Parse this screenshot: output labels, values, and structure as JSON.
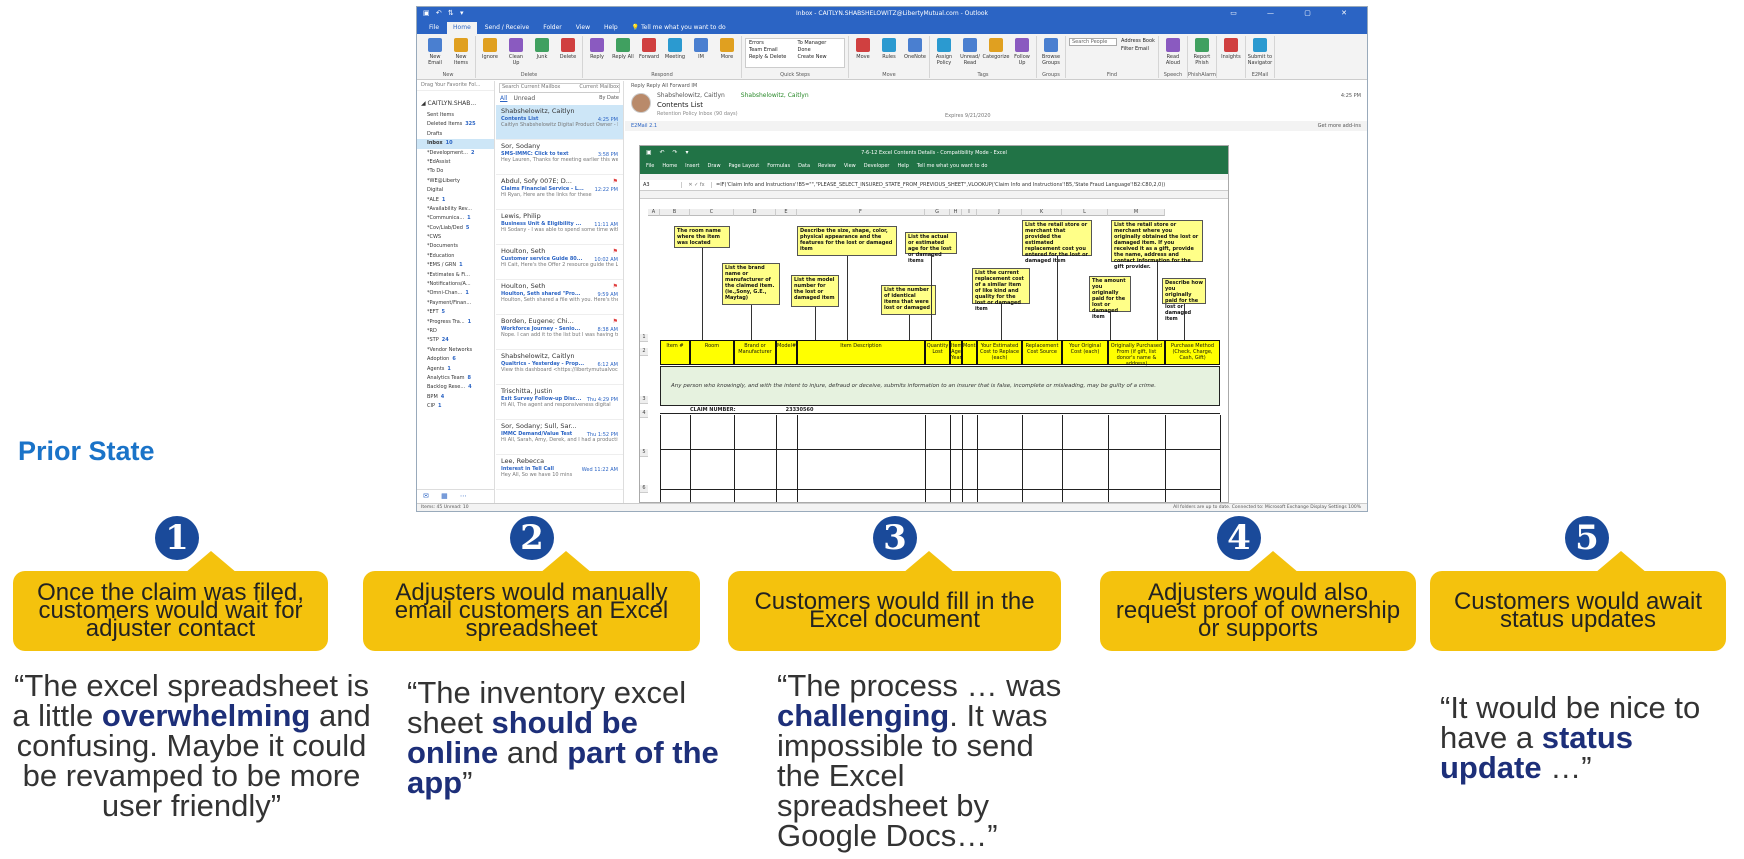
{
  "outlook": {
    "window_title": "Inbox - CAITLYN.SHABSHELOWITZ@LibertyMutual.com - Outlook",
    "menu_tabs": [
      "File",
      "Home",
      "Send / Receive",
      "Folder",
      "View",
      "Help"
    ],
    "tell_me": "Tell me what you want to do",
    "ribbon_groups": [
      {
        "label": "New",
        "buttons": [
          "New Email",
          "New Items"
        ]
      },
      {
        "label": "Delete",
        "buttons": [
          "Ignore",
          "Clean Up",
          "Junk",
          "Delete"
        ]
      },
      {
        "label": "Respond",
        "buttons": [
          "Reply",
          "Reply All",
          "Forward",
          "Meeting",
          "IM",
          "More"
        ]
      },
      {
        "label": "Quick Steps",
        "buttons": [
          "Errors",
          "Team Email",
          "Reply & Delete",
          "To Manager",
          "Done",
          "Create New"
        ]
      },
      {
        "label": "Move",
        "buttons": [
          "Move",
          "Rules",
          "OneNote"
        ]
      },
      {
        "label": "Tags",
        "buttons": [
          "Assign Policy",
          "Unread/ Read",
          "Categorize",
          "Follow Up"
        ]
      },
      {
        "label": "Groups",
        "buttons": [
          "Browse Groups"
        ]
      },
      {
        "label": "Find",
        "buttons": [
          "Search People",
          "Address Book",
          "Filter Email"
        ]
      },
      {
        "label": "Speech",
        "buttons": [
          "Read Aloud"
        ]
      },
      {
        "label": "PhishAlarm",
        "buttons": [
          "Report Phish"
        ]
      },
      {
        "label": "",
        "buttons": [
          "Insights"
        ]
      },
      {
        "label": "E2Mail",
        "buttons": [
          "Submit to Navigator"
        ]
      }
    ],
    "favorites_hint": "Drag Your Favorite Fol...",
    "folders": [
      {
        "name": "CAITLYN.SHAB...",
        "count": "",
        "kind": "acct"
      },
      {
        "name": "Sent Items",
        "count": ""
      },
      {
        "name": "Deleted Items",
        "count": "325"
      },
      {
        "name": "Drafts",
        "count": ""
      },
      {
        "name": "Inbox",
        "count": "10",
        "kind": "sel"
      },
      {
        "name": "*Development...",
        "count": "2"
      },
      {
        "name": "*EdAssist",
        "count": ""
      },
      {
        "name": "*To Do",
        "count": ""
      },
      {
        "name": "*WE@Liberty",
        "count": ""
      },
      {
        "name": "Digital",
        "count": ""
      },
      {
        "name": "*ALE",
        "count": "1"
      },
      {
        "name": "*Availability Rev...",
        "count": ""
      },
      {
        "name": "*Communica...",
        "count": "1"
      },
      {
        "name": "*Cov/Liab/Ded",
        "count": "5"
      },
      {
        "name": "*CWS",
        "count": ""
      },
      {
        "name": "*Documents",
        "count": ""
      },
      {
        "name": "*Education",
        "count": ""
      },
      {
        "name": "*EMS / GRN",
        "count": "1"
      },
      {
        "name": "*Estimates & Fi...",
        "count": ""
      },
      {
        "name": "*Notifications/A...",
        "count": ""
      },
      {
        "name": "*Omni-Chan...",
        "count": "1"
      },
      {
        "name": "*Payment/Finan...",
        "count": ""
      },
      {
        "name": "*EFT",
        "count": "5"
      },
      {
        "name": "*Progress Tra...",
        "count": "1"
      },
      {
        "name": "*RD",
        "count": ""
      },
      {
        "name": "*STP",
        "count": "24"
      },
      {
        "name": "*Vendor Networks",
        "count": ""
      },
      {
        "name": "Adoption",
        "count": "6"
      },
      {
        "name": "Agents",
        "count": "1"
      },
      {
        "name": "Analytics Team",
        "count": "8"
      },
      {
        "name": "Backlog Rese...",
        "count": "4"
      },
      {
        "name": "BPM",
        "count": "4"
      },
      {
        "name": "CIP",
        "count": "1"
      }
    ],
    "list_search": "Search Current Mailbox",
    "list_scope": "Current Mailbox",
    "filters": [
      "All",
      "Unread"
    ],
    "sort": "By Date",
    "mails": [
      {
        "sender": "Shabshelowitz, Caitlyn",
        "subject": "Contents List",
        "preview": "Caitlyn Shabshelowitz Digital Product Owner - I",
        "time": "4:25 PM",
        "selected": true,
        "flag": ""
      },
      {
        "sender": "Sor, Sodany",
        "subject": "SMS-IMMC: Click to text",
        "preview": "Hey Lauren, Thanks for meeting earlier this week.",
        "time": "3:58 PM",
        "selected": false,
        "flag": ""
      },
      {
        "sender": "Abdul, Sofy 007E; D...",
        "subject": "Claims Financial Service - L...",
        "preview": "Hi Ryan, Here are the links for these",
        "time": "12:22 PM",
        "selected": false,
        "flag": "⚑"
      },
      {
        "sender": "Lewis, Philip",
        "subject": "Business Unit & Eligibility ...",
        "preview": "Hi Sodany - I was able to spend some time with the",
        "time": "11:11 AM",
        "selected": false,
        "flag": ""
      },
      {
        "sender": "Houlton, Seth",
        "subject": "Customer service Guide 80...",
        "preview": "Hi Cait, Here's the Offer 2 resource guide the Lake",
        "time": "10:02 AM",
        "selected": false,
        "flag": "⚑"
      },
      {
        "sender": "Houlton, Seth",
        "subject": "Houlton, Seth shared \"Pro...",
        "preview": "Houlton, Seth shared a file with you. Here's the Offer 2",
        "time": "9:59 AM",
        "selected": false,
        "flag": "⚑"
      },
      {
        "sender": "Borden, Eugene; Chi...",
        "subject": "Workforce Journey - Senio...",
        "preview": "Nope. I can add it to the list but I was having trouble",
        "time": "8:38 AM",
        "selected": false,
        "flag": "⚑"
      },
      {
        "sender": "Shabshelowitz, Caitlyn",
        "subject": "Qualtrics - Yesterday - Prop...",
        "preview": "View this dashboard <https://libertymutualvoc.co",
        "time": "6:12 AM",
        "selected": false,
        "flag": ""
      },
      {
        "sender": "Trischitta, Justin",
        "subject": "Exit Survey Follow-up Disc...",
        "preview": "Hi All, The agent and responsiveness digital",
        "time": "Thu 4:29 PM",
        "selected": false,
        "flag": ""
      },
      {
        "sender": "Sor, Sodany; Sull, Sar...",
        "subject": "IMMC Demand/Value Test",
        "preview": "Hi All, Sarah, Amy, Derek, and I had a productive",
        "time": "Thu 1:52 PM",
        "selected": false,
        "flag": ""
      },
      {
        "sender": "Lee, Rebecca",
        "subject": "Interest in Tell Call",
        "preview": "Hey All, So we have 10 mins",
        "time": "Wed 11:22 AM",
        "selected": false,
        "flag": ""
      }
    ],
    "reading": {
      "actions": "Reply   Reply All   Forward   IM",
      "from": "Shabshelowitz, Caitlyn",
      "to": "Shabshelowitz, Caitlyn",
      "subject": "Contents List",
      "retention": "Retention Policy   Inbox (90 days)",
      "expires": "Expires   9/21/2020",
      "time": "4:25 PM",
      "addin": "E2Mail 2.1",
      "more_addins": "Get more add-ins"
    },
    "excel": {
      "title": "7-6-12 Excel Contents Details - Compatibility Mode - Excel",
      "menu": [
        "File",
        "Home",
        "Insert",
        "Draw",
        "Page Layout",
        "Formulas",
        "Data",
        "Review",
        "View",
        "Developer",
        "Help",
        "Tell me what you want to do"
      ],
      "cell_ref": "A3",
      "formula": "=IF('Claim Info and Instructions'!B5=\"\",\"PLEASE_SELECT_INSURED_STATE_FROM_PREVIOUS_SHEET\",VLOOKUP('Claim Info and Instructions'!B5,'State Fraud Language'!B2:C80,2,0))",
      "columns": [
        "A",
        "B",
        "C",
        "D",
        "E",
        "F",
        "G",
        "H",
        "I",
        "J",
        "K",
        "L",
        "M"
      ],
      "notes": [
        "The room name where the item was located",
        "List the brand name or manufacturer of the claimed item. (ie.,Sony, G.E., Maytag)",
        "List the model number for the lost or damaged item",
        "Describe the size, shape, color, physical appearance and the features for the lost or damaged item",
        "List the number of identical items that were lost or damaged",
        "List the actual or estimated age for the lost or damaged items",
        "List the current replacement cost of a similar item of like kind and quality for the lost or damaged item",
        "List the retail store or merchant that provided the estimated replacement cost you entered for the lost or damaged item",
        "The amount you originally paid for the lost or damaged item",
        "List the retail store or merchant where you originally obtained the lost or damaged item. If you received it as a gift, provide the name, address and contact information for the gift provider.",
        "Describe how you originally paid for the lost or damaged item"
      ],
      "headers": [
        "Item #",
        "Room",
        "Brand or Manufacturer",
        "Model#",
        "Item Description",
        "Quantity Lost",
        "Item Age Years",
        "Months",
        "Your Estimated Cost to Replace (each)",
        "Replacement Cost Source",
        "Your Original Cost (each)",
        "Originally Purchased From (if gift, list donor's name & address)",
        "Purchase Method (Check, Charge, Cash, Gift)"
      ],
      "fraud_text": "Any person who knowingly, and with the intent to injure, defraud or deceive, submits information to an insurer that is false, incomplete or misleading, may be guilty of a crime.",
      "claim_label": "CLAIM NUMBER:",
      "claim_number": "23330560",
      "rows": [
        "1",
        "2",
        "3",
        "4",
        "5",
        "6"
      ]
    },
    "status_left": "Items: 45    Unread: 10",
    "status_right": "All folders are up to date.    Connected to: Microsoft Exchange    Display Settings    100%"
  },
  "journey": {
    "prior_state": "Prior State",
    "steps": [
      {
        "num": "1",
        "text": "Once the claim was filed, customers would wait for adjuster contact"
      },
      {
        "num": "2",
        "text": "Adjusters would manually email customers an Excel spreadsheet"
      },
      {
        "num": "3",
        "text": "Customers would fill in the Excel document"
      },
      {
        "num": "4",
        "text": "Adjusters would also request proof of ownership or supports"
      },
      {
        "num": "5",
        "text": "Customers would await status updates"
      }
    ],
    "quotes": [
      {
        "pre": "“The excel spreadsheet is a little ",
        "bold": "overwhelming",
        "post": " and confusing. Maybe it could be revamped to be more user friendly”"
      },
      {
        "pre": "“The inventory excel sheet ",
        "bold": "should be online",
        "mid": " and ",
        "bold2": "part of the app",
        "post": "”"
      },
      {
        "pre": "“The process … was ",
        "bold": "challenging",
        "post": ". It was impossible to send the Excel spreadsheet by Google Docs…”"
      },
      {
        "pre": "",
        "bold": "",
        "post": ""
      },
      {
        "pre": "“It would be nice to have a ",
        "bold": "status update",
        "post": " …”"
      }
    ]
  }
}
